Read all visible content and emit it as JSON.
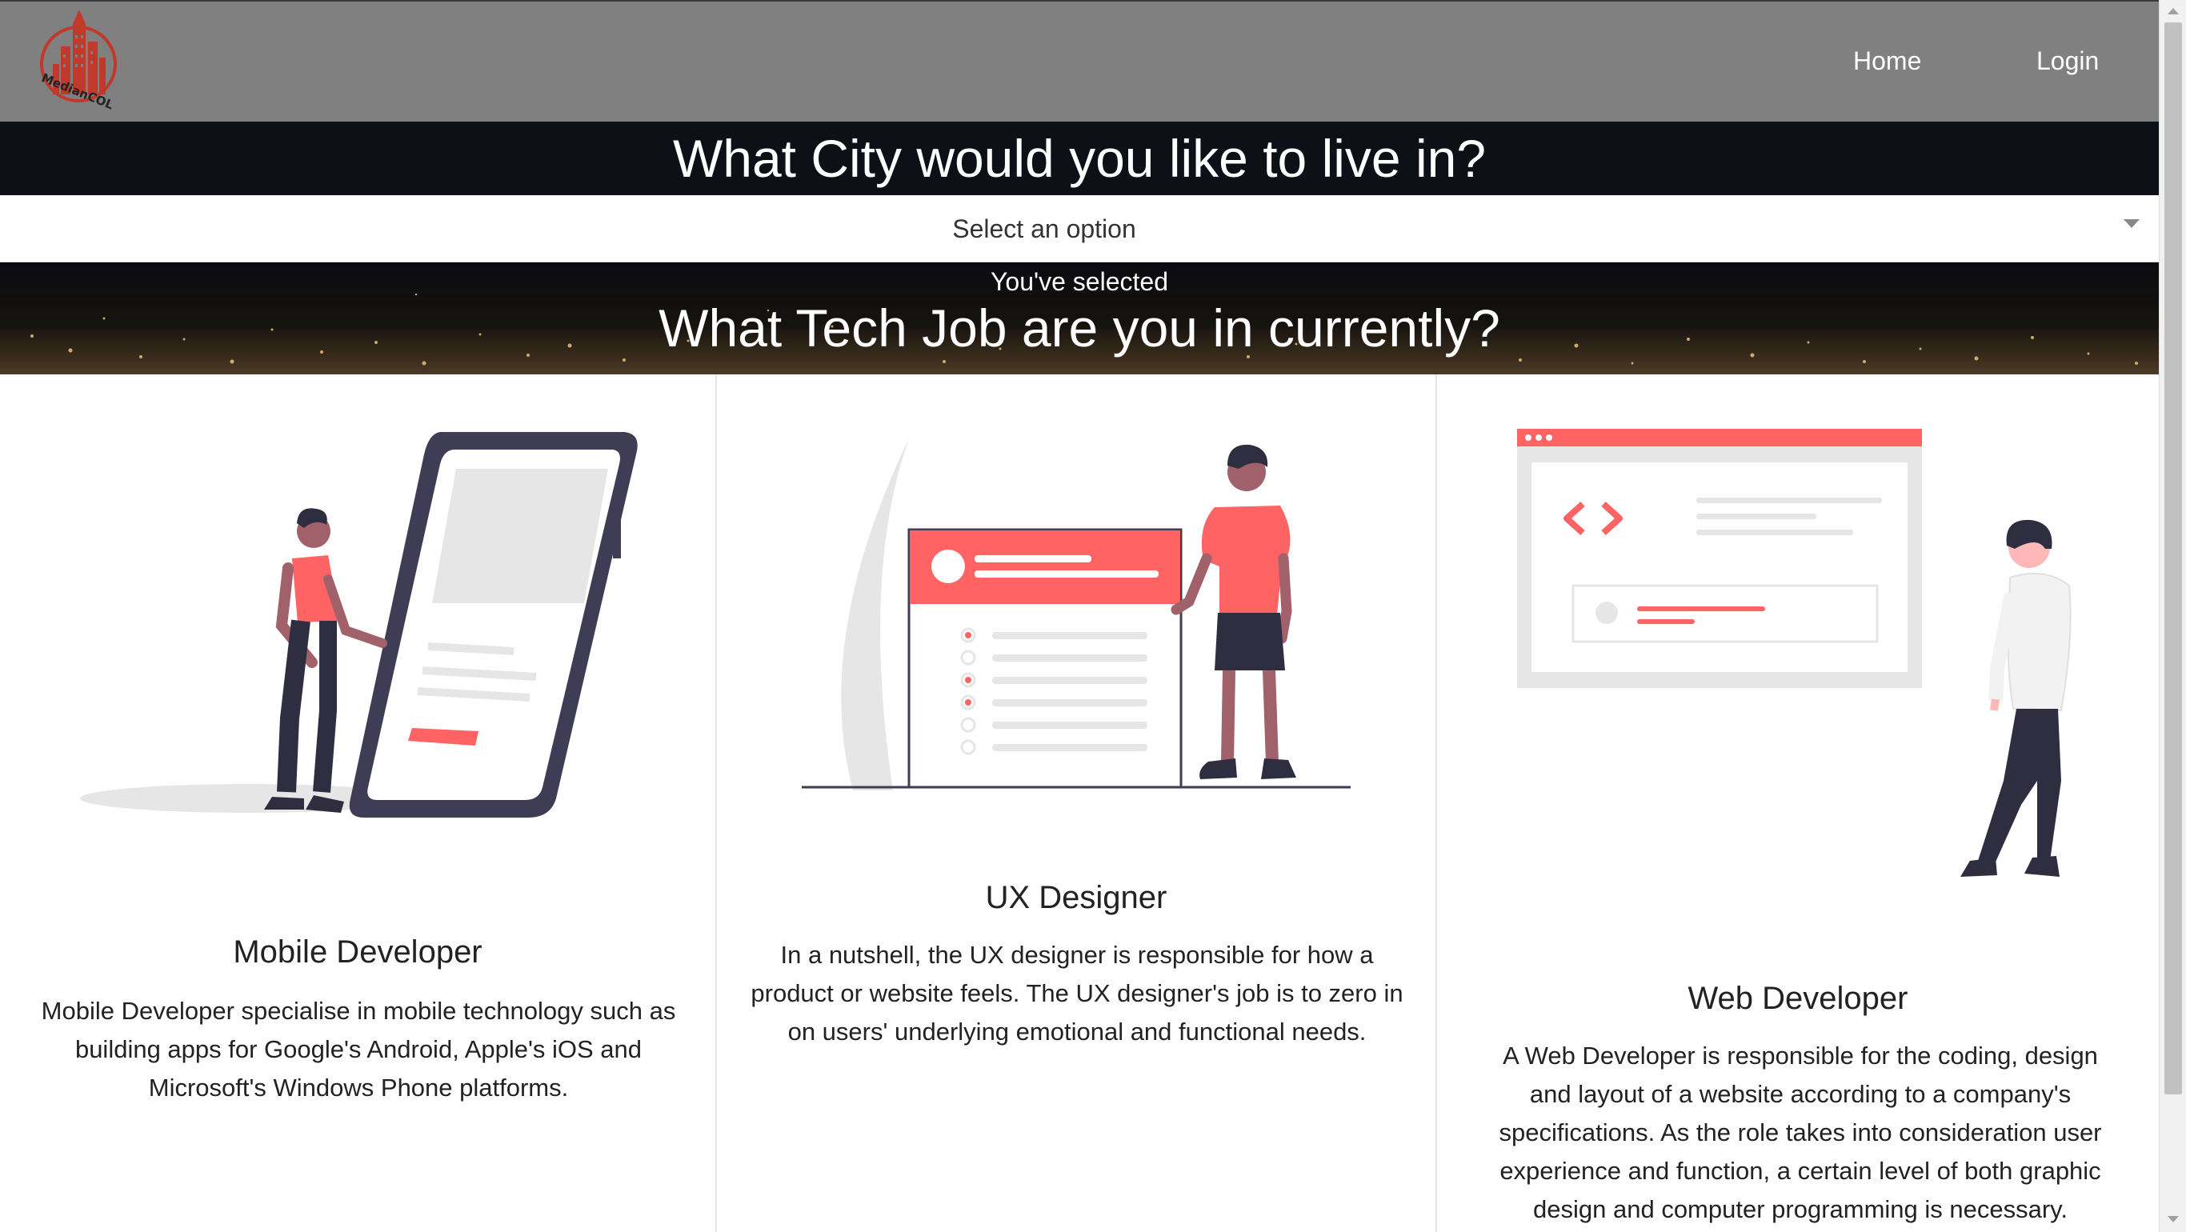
{
  "nav": {
    "logo_text": "MedianCOL",
    "home_label": "Home",
    "login_label": "Login"
  },
  "city_question": "What City would you like to live in?",
  "city_select": {
    "placeholder": "Select an option"
  },
  "selected_label": "You've selected",
  "job_question": "What Tech Job are you in currently?",
  "jobs": [
    {
      "title": "Mobile Developer",
      "description": "Mobile Developer specialise in mobile technology such as building apps for Google's Android, Apple's iOS and Microsoft's Windows Phone platforms."
    },
    {
      "title": "UX Designer",
      "description": "In a nutshell, the UX designer is responsible for how a product or website feels. The UX designer's job is to zero in on users' underlying emotional and functional needs."
    },
    {
      "title": "Web Developer",
      "description": "A Web Developer is responsible for the coding, design and layout of a website according to a company's specifications. As the role takes into consideration user experience and function, a certain level of both graphic design and computer programming is necessary."
    }
  ],
  "colors": {
    "navbar": "#808080",
    "dark_band": "#0d1117",
    "accent": "#ff6363",
    "logo_red": "#c0392b"
  }
}
